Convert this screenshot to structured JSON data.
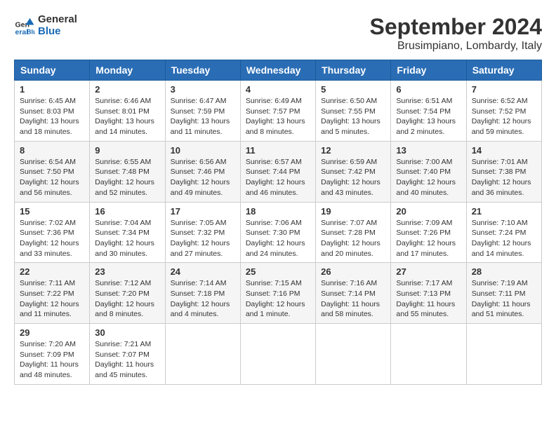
{
  "header": {
    "logo_general": "General",
    "logo_blue": "Blue",
    "main_title": "September 2024",
    "subtitle": "Brusimpiano, Lombardy, Italy"
  },
  "calendar": {
    "days_of_week": [
      "Sunday",
      "Monday",
      "Tuesday",
      "Wednesday",
      "Thursday",
      "Friday",
      "Saturday"
    ],
    "weeks": [
      [
        {
          "day": "1",
          "info": "Sunrise: 6:45 AM\nSunset: 8:03 PM\nDaylight: 13 hours and 18 minutes."
        },
        {
          "day": "2",
          "info": "Sunrise: 6:46 AM\nSunset: 8:01 PM\nDaylight: 13 hours and 14 minutes."
        },
        {
          "day": "3",
          "info": "Sunrise: 6:47 AM\nSunset: 7:59 PM\nDaylight: 13 hours and 11 minutes."
        },
        {
          "day": "4",
          "info": "Sunrise: 6:49 AM\nSunset: 7:57 PM\nDaylight: 13 hours and 8 minutes."
        },
        {
          "day": "5",
          "info": "Sunrise: 6:50 AM\nSunset: 7:55 PM\nDaylight: 13 hours and 5 minutes."
        },
        {
          "day": "6",
          "info": "Sunrise: 6:51 AM\nSunset: 7:54 PM\nDaylight: 13 hours and 2 minutes."
        },
        {
          "day": "7",
          "info": "Sunrise: 6:52 AM\nSunset: 7:52 PM\nDaylight: 12 hours and 59 minutes."
        }
      ],
      [
        {
          "day": "8",
          "info": "Sunrise: 6:54 AM\nSunset: 7:50 PM\nDaylight: 12 hours and 56 minutes."
        },
        {
          "day": "9",
          "info": "Sunrise: 6:55 AM\nSunset: 7:48 PM\nDaylight: 12 hours and 52 minutes."
        },
        {
          "day": "10",
          "info": "Sunrise: 6:56 AM\nSunset: 7:46 PM\nDaylight: 12 hours and 49 minutes."
        },
        {
          "day": "11",
          "info": "Sunrise: 6:57 AM\nSunset: 7:44 PM\nDaylight: 12 hours and 46 minutes."
        },
        {
          "day": "12",
          "info": "Sunrise: 6:59 AM\nSunset: 7:42 PM\nDaylight: 12 hours and 43 minutes."
        },
        {
          "day": "13",
          "info": "Sunrise: 7:00 AM\nSunset: 7:40 PM\nDaylight: 12 hours and 40 minutes."
        },
        {
          "day": "14",
          "info": "Sunrise: 7:01 AM\nSunset: 7:38 PM\nDaylight: 12 hours and 36 minutes."
        }
      ],
      [
        {
          "day": "15",
          "info": "Sunrise: 7:02 AM\nSunset: 7:36 PM\nDaylight: 12 hours and 33 minutes."
        },
        {
          "day": "16",
          "info": "Sunrise: 7:04 AM\nSunset: 7:34 PM\nDaylight: 12 hours and 30 minutes."
        },
        {
          "day": "17",
          "info": "Sunrise: 7:05 AM\nSunset: 7:32 PM\nDaylight: 12 hours and 27 minutes."
        },
        {
          "day": "18",
          "info": "Sunrise: 7:06 AM\nSunset: 7:30 PM\nDaylight: 12 hours and 24 minutes."
        },
        {
          "day": "19",
          "info": "Sunrise: 7:07 AM\nSunset: 7:28 PM\nDaylight: 12 hours and 20 minutes."
        },
        {
          "day": "20",
          "info": "Sunrise: 7:09 AM\nSunset: 7:26 PM\nDaylight: 12 hours and 17 minutes."
        },
        {
          "day": "21",
          "info": "Sunrise: 7:10 AM\nSunset: 7:24 PM\nDaylight: 12 hours and 14 minutes."
        }
      ],
      [
        {
          "day": "22",
          "info": "Sunrise: 7:11 AM\nSunset: 7:22 PM\nDaylight: 12 hours and 11 minutes."
        },
        {
          "day": "23",
          "info": "Sunrise: 7:12 AM\nSunset: 7:20 PM\nDaylight: 12 hours and 8 minutes."
        },
        {
          "day": "24",
          "info": "Sunrise: 7:14 AM\nSunset: 7:18 PM\nDaylight: 12 hours and 4 minutes."
        },
        {
          "day": "25",
          "info": "Sunrise: 7:15 AM\nSunset: 7:16 PM\nDaylight: 12 hours and 1 minute."
        },
        {
          "day": "26",
          "info": "Sunrise: 7:16 AM\nSunset: 7:14 PM\nDaylight: 11 hours and 58 minutes."
        },
        {
          "day": "27",
          "info": "Sunrise: 7:17 AM\nSunset: 7:13 PM\nDaylight: 11 hours and 55 minutes."
        },
        {
          "day": "28",
          "info": "Sunrise: 7:19 AM\nSunset: 7:11 PM\nDaylight: 11 hours and 51 minutes."
        }
      ],
      [
        {
          "day": "29",
          "info": "Sunrise: 7:20 AM\nSunset: 7:09 PM\nDaylight: 11 hours and 48 minutes."
        },
        {
          "day": "30",
          "info": "Sunrise: 7:21 AM\nSunset: 7:07 PM\nDaylight: 11 hours and 45 minutes."
        },
        null,
        null,
        null,
        null,
        null
      ]
    ]
  }
}
